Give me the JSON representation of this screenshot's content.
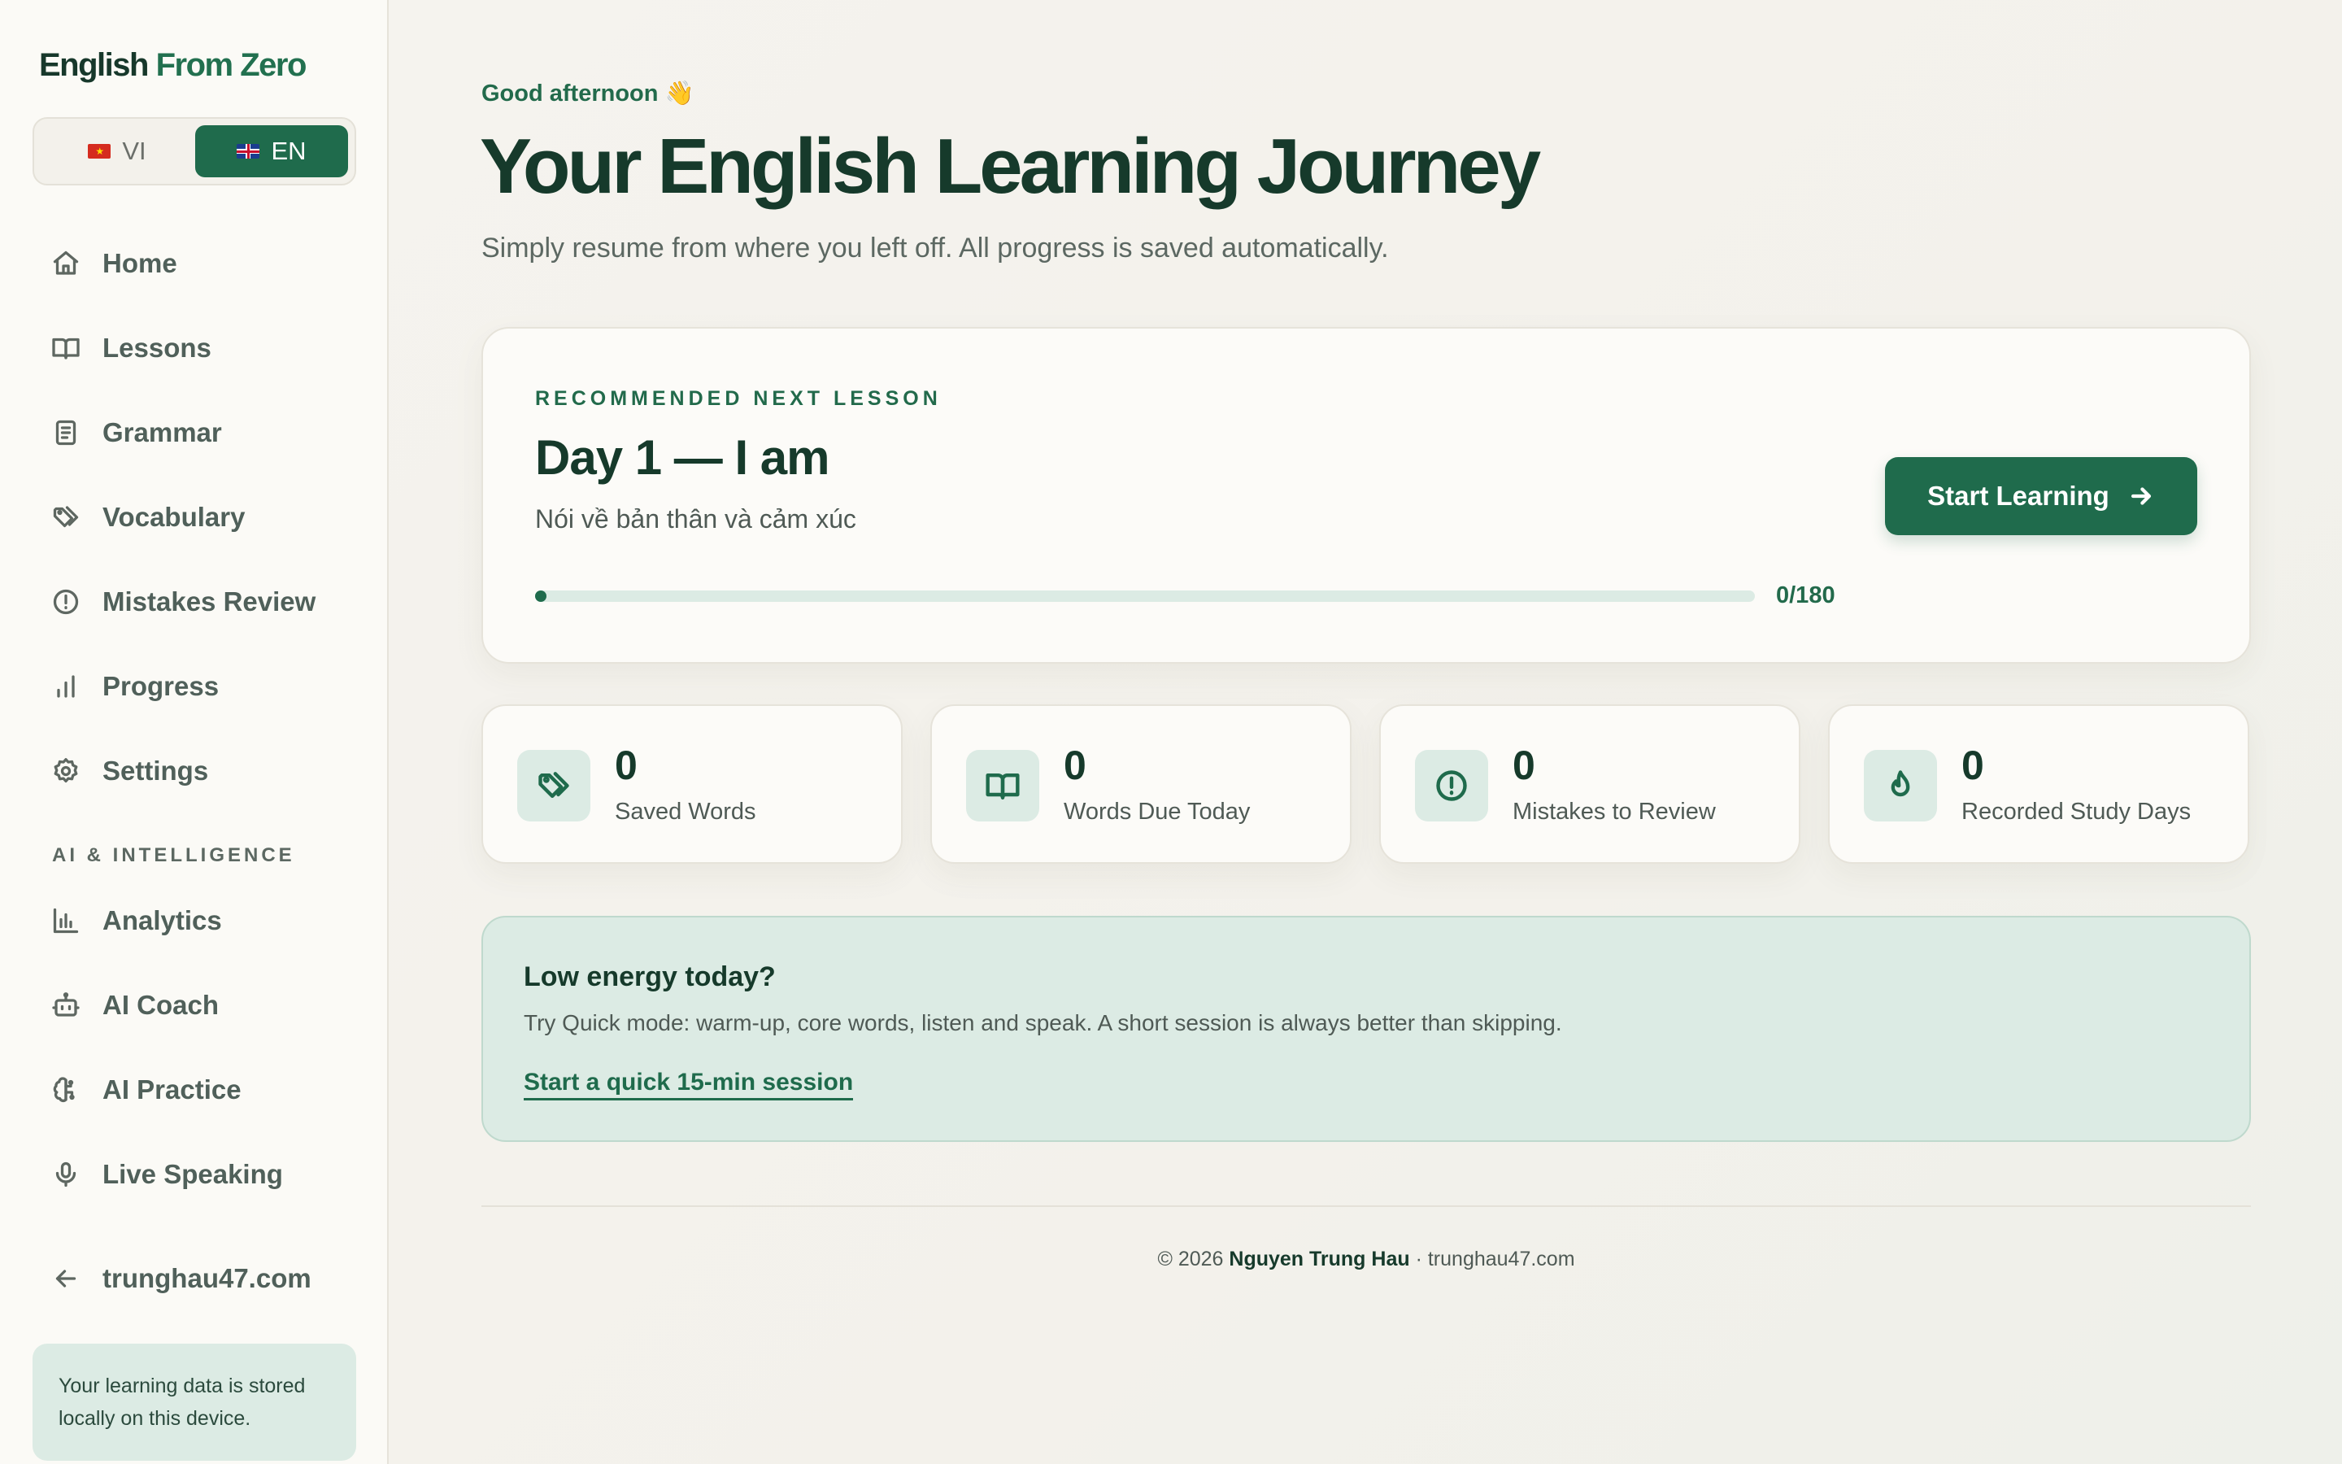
{
  "brand": {
    "main": "English",
    "accent": "From Zero"
  },
  "language_switch": {
    "vi_label": "VI",
    "en_label": "EN",
    "active": "EN"
  },
  "nav": {
    "home": "Home",
    "lessons": "Lessons",
    "grammar": "Grammar",
    "vocabulary": "Vocabulary",
    "mistakes_review": "Mistakes Review",
    "progress": "Progress",
    "settings": "Settings",
    "section_ai": "AI & INTELLIGENCE",
    "analytics": "Analytics",
    "ai_coach": "AI Coach",
    "ai_practice": "AI Practice",
    "live_speaking": "Live Speaking",
    "back_site": "trunghau47.com"
  },
  "storage_note": "Your learning data is stored locally on this device.",
  "header": {
    "greeting": "Good afternoon 👋",
    "title": "Your English Learning Journey",
    "subtitle": "Simply resume from where you left off. All progress is saved automatically."
  },
  "recommended": {
    "eyebrow": "RECOMMENDED NEXT LESSON",
    "title": "Day 1 — I am",
    "description": "Nói về bản thân và cảm xúc",
    "progress_text": "0/180",
    "progress_fraction": 0,
    "button_label": "Start Learning"
  },
  "stats": [
    {
      "value": "0",
      "label": "Saved Words",
      "icon": "tag-icon"
    },
    {
      "value": "0",
      "label": "Words Due Today",
      "icon": "book-open-icon"
    },
    {
      "value": "0",
      "label": "Mistakes to Review",
      "icon": "alert-circle-icon"
    },
    {
      "value": "0",
      "label": "Recorded Study Days",
      "icon": "flame-icon"
    }
  ],
  "quick_tip": {
    "title": "Low energy today?",
    "text": "Try Quick mode: warm-up, core words, listen and speak. A short session is always better than skipping.",
    "link": "Start a quick 15-min session"
  },
  "footer": {
    "prefix": "© 2026",
    "author": "Nguyen Trung Hau",
    "separator": "·",
    "site": "trunghau47.com"
  },
  "colors": {
    "accent": "#1f6b4c",
    "accent_soft": "#dcebe4",
    "text_dark": "#163a2b",
    "background": "#f4f2ec"
  }
}
